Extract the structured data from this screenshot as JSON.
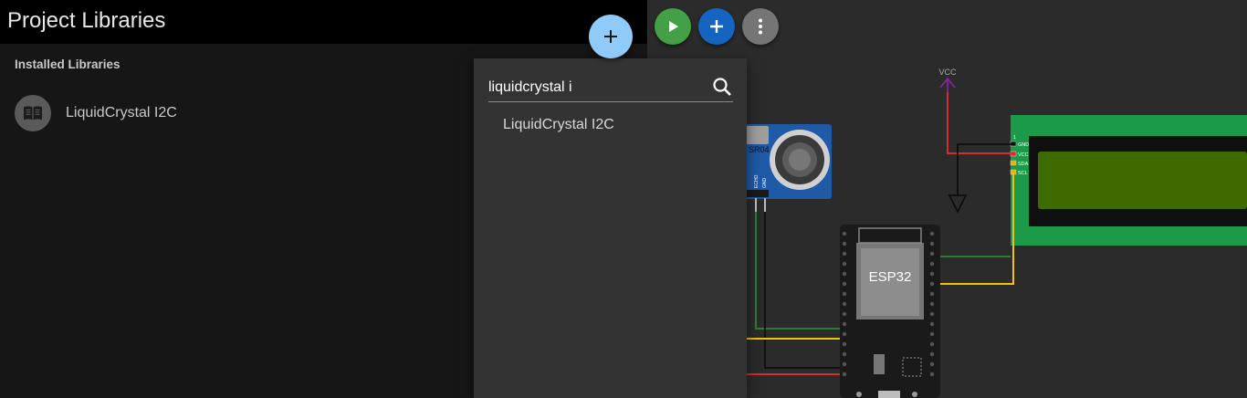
{
  "panel": {
    "title": "Project Libraries",
    "section_title": "Installed Libraries",
    "installed": [
      {
        "name": "LiquidCrystal I2C",
        "icon": "book-icon"
      }
    ],
    "add_button_icon": "plus-icon"
  },
  "toolbar": {
    "play_icon": "play-icon",
    "add_icon": "plus-icon",
    "menu_icon": "more-vertical-icon"
  },
  "search": {
    "value": "liquidcrystal i",
    "icon": "search-icon",
    "results": [
      "LiquidCrystal I2C"
    ]
  },
  "diagram": {
    "vcc_label": "VCC",
    "sensor_label": "SR04",
    "sensor_pins": [
      "ECHO",
      "GND"
    ],
    "esp32_label": "ESP32",
    "lcd_pins": [
      "GND",
      "VCC",
      "SDA",
      "SCL"
    ],
    "lcd_pin1": "1"
  },
  "colors": {
    "accent_blue": "#1565c0",
    "fab_light_blue": "#90caf9",
    "play_green": "#43a047",
    "menu_gray": "#757575",
    "wire_red": "#d32f2f",
    "wire_green": "#2e7d32",
    "wire_yellow": "#fbc02d",
    "vcc_purple": "#8e24aa",
    "lcd_green": "#1b9a4a",
    "lcd_screen": "#3d6b00"
  }
}
